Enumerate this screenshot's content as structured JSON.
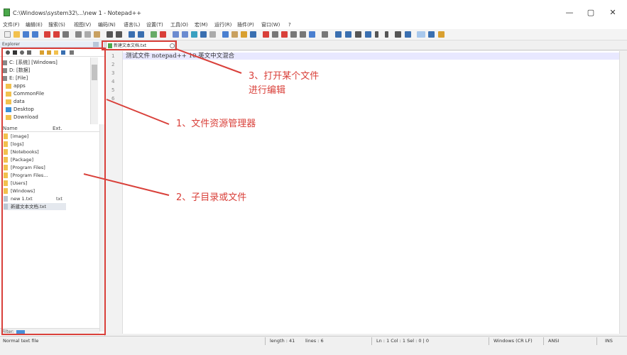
{
  "window": {
    "title": "C:\\Windows\\system32\\...\\new 1 - Notepad++",
    "min_glyph": "—",
    "max_glyph": "▢",
    "close_glyph": "✕"
  },
  "menu": [
    "文件(F)",
    "编辑(E)",
    "搜索(S)",
    "视图(V)",
    "编码(N)",
    "语言(L)",
    "设置(T)",
    "工具(O)",
    "宏(M)",
    "运行(R)",
    "插件(P)",
    "窗口(W)",
    "?"
  ],
  "explorer": {
    "title": "Explorer",
    "tree": [
      {
        "label": "C: [系统] [Windows]",
        "icon": "drive-icon"
      },
      {
        "label": "D: [数据]",
        "icon": "drive-icon"
      },
      {
        "label": "E: [File]",
        "icon": "drive-icon"
      },
      {
        "label": "apps",
        "icon": "folder-icon"
      },
      {
        "label": "CommonFile",
        "icon": "folder-icon"
      },
      {
        "label": "data",
        "icon": "folder-icon"
      },
      {
        "label": "Desktop",
        "icon": "desktop-icon"
      },
      {
        "label": "Download",
        "icon": "folder-icon"
      }
    ],
    "columns": {
      "name": "Name",
      "ext": "Ext."
    },
    "files": [
      {
        "name": "[image]",
        "ext": ""
      },
      {
        "name": "[logs]",
        "ext": ""
      },
      {
        "name": "[Notebooks]",
        "ext": ""
      },
      {
        "name": "[Package]",
        "ext": ""
      },
      {
        "name": "[Program Files]",
        "ext": ""
      },
      {
        "name": "[Program Files...",
        "ext": ""
      },
      {
        "name": "[Users]",
        "ext": ""
      },
      {
        "name": "[Windows]",
        "ext": ""
      },
      {
        "name": "new 1.txt",
        "ext": "txt"
      },
      {
        "name": "新建文本文档.txt",
        "ext": ""
      }
    ],
    "filter_label": "Filter:"
  },
  "tab": {
    "label": "新建文本文档.txt"
  },
  "editor": {
    "line_numbers": [
      "1",
      "2",
      "3",
      "4",
      "5",
      "6"
    ],
    "line1": "测试文件 notepad++ 10 英文中文混合"
  },
  "status": {
    "file_type": "Normal text file",
    "length": "length : 41",
    "lines": "lines : 6",
    "position": "Ln : 1    Col : 1    Sel : 0 | 0",
    "eol": "Windows (CR LF)",
    "encoding": "ANSI",
    "mode": "INS"
  },
  "annotations": {
    "a1": "1、文件资源管理器",
    "a2": "2、子目录或文件",
    "a3_line1": "3、打开某个文件",
    "a3_line2": "进行编辑"
  },
  "colors": {
    "annotation": "#d9403a",
    "folder": "#f2c14e"
  }
}
